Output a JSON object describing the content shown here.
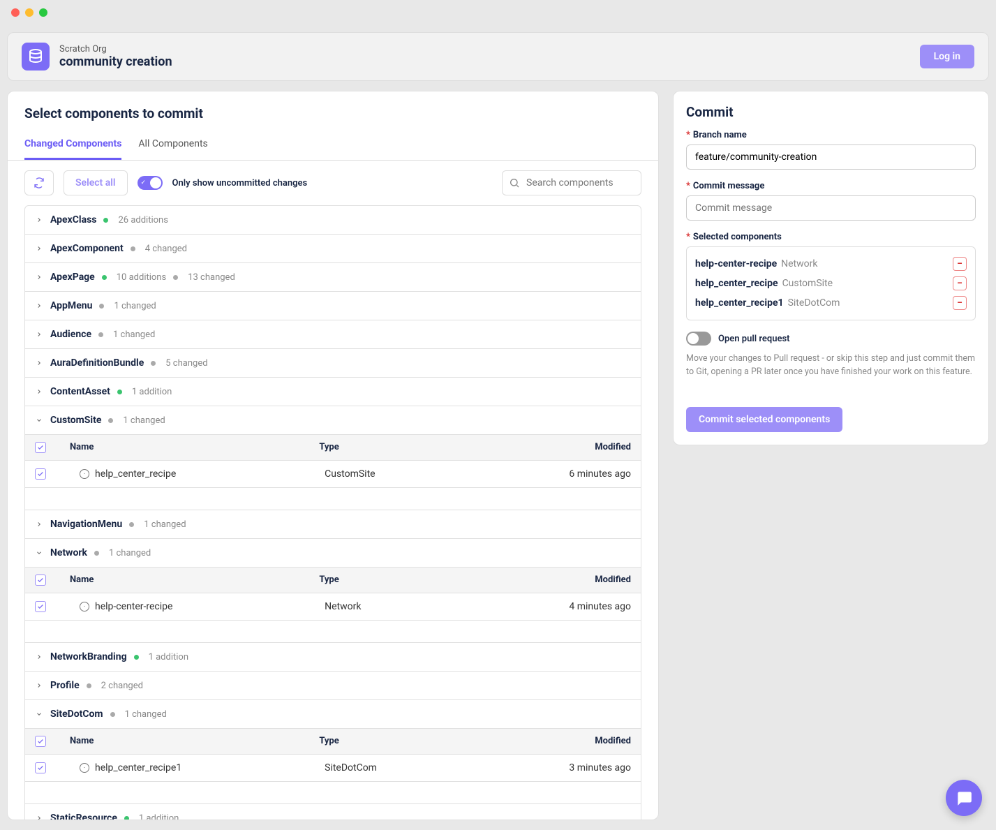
{
  "header": {
    "subtitle": "Scratch Org",
    "title": "community creation",
    "login_label": "Log in"
  },
  "left": {
    "title": "Select components to commit",
    "tabs": [
      {
        "label": "Changed Components",
        "active": true
      },
      {
        "label": "All Components",
        "active": false
      }
    ],
    "select_all_label": "Select all",
    "toggle_label": "Only show uncommitted changes",
    "search_placeholder": "Search components",
    "table_headers": {
      "name": "Name",
      "type": "Type",
      "modified": "Modified"
    },
    "groups": [
      {
        "name": "ApexClass",
        "expanded": false,
        "badges": [
          {
            "color": "green",
            "text": "26 additions"
          }
        ]
      },
      {
        "name": "ApexComponent",
        "expanded": false,
        "badges": [
          {
            "color": "grey",
            "text": "4 changed"
          }
        ]
      },
      {
        "name": "ApexPage",
        "expanded": false,
        "badges": [
          {
            "color": "green",
            "text": "10 additions"
          },
          {
            "color": "grey",
            "text": "13 changed"
          }
        ]
      },
      {
        "name": "AppMenu",
        "expanded": false,
        "badges": [
          {
            "color": "grey",
            "text": "1 changed"
          }
        ]
      },
      {
        "name": "Audience",
        "expanded": false,
        "badges": [
          {
            "color": "grey",
            "text": "1 changed"
          }
        ]
      },
      {
        "name": "AuraDefinitionBundle",
        "expanded": false,
        "badges": [
          {
            "color": "grey",
            "text": "5 changed"
          }
        ]
      },
      {
        "name": "ContentAsset",
        "expanded": false,
        "badges": [
          {
            "color": "green",
            "text": "1 addition"
          }
        ]
      },
      {
        "name": "CustomSite",
        "expanded": true,
        "badges": [
          {
            "color": "grey",
            "text": "1 changed"
          }
        ],
        "items": [
          {
            "name": "help_center_recipe",
            "type": "CustomSite",
            "modified": "6 minutes ago",
            "checked": true
          }
        ]
      },
      {
        "name": "NavigationMenu",
        "expanded": false,
        "badges": [
          {
            "color": "grey",
            "text": "1 changed"
          }
        ]
      },
      {
        "name": "Network",
        "expanded": true,
        "badges": [
          {
            "color": "grey",
            "text": "1 changed"
          }
        ],
        "items": [
          {
            "name": "help-center-recipe",
            "type": "Network",
            "modified": "4 minutes ago",
            "checked": true
          }
        ]
      },
      {
        "name": "NetworkBranding",
        "expanded": false,
        "badges": [
          {
            "color": "green",
            "text": "1 addition"
          }
        ]
      },
      {
        "name": "Profile",
        "expanded": false,
        "badges": [
          {
            "color": "grey",
            "text": "2 changed"
          }
        ]
      },
      {
        "name": "SiteDotCom",
        "expanded": true,
        "badges": [
          {
            "color": "grey",
            "text": "1 changed"
          }
        ],
        "items": [
          {
            "name": "help_center_recipe1",
            "type": "SiteDotCom",
            "modified": "3 minutes ago",
            "checked": true
          }
        ]
      },
      {
        "name": "StaticResource",
        "expanded": false,
        "badges": [
          {
            "color": "green",
            "text": "1 addition"
          }
        ]
      }
    ]
  },
  "right": {
    "title": "Commit",
    "branch_label": "Branch name",
    "branch_value": "feature/community-creation",
    "message_label": "Commit message",
    "message_placeholder": "Commit message",
    "selected_label": "Selected components",
    "selected": [
      {
        "name": "help-center-recipe",
        "type": "Network"
      },
      {
        "name": "help_center_recipe",
        "type": "CustomSite"
      },
      {
        "name": "help_center_recipe1",
        "type": "SiteDotCom"
      }
    ],
    "pr_toggle_label": "Open pull request",
    "help_text": "Move your changes to Pull request - or skip this step and just commit them to Git, opening a PR later once you have finished your work on this feature.",
    "commit_button": "Commit selected components"
  }
}
